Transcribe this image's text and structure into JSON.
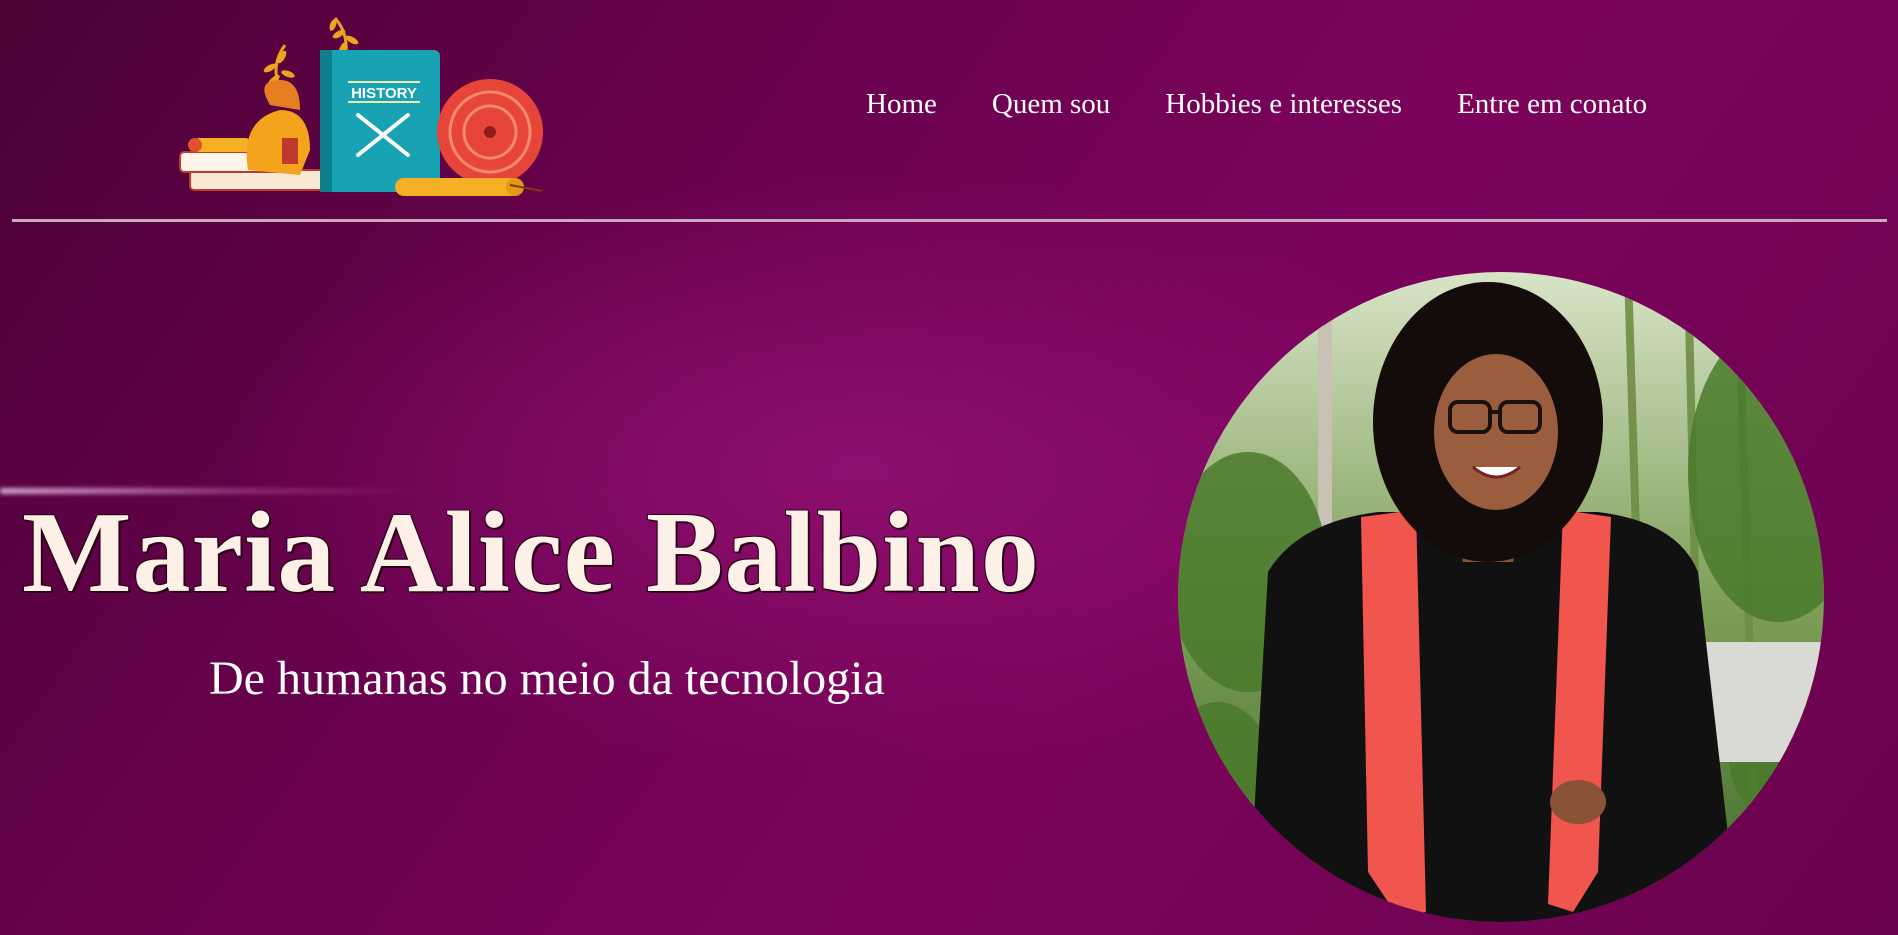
{
  "logo": {
    "book_label": "HISTORY"
  },
  "nav": {
    "items": [
      {
        "label": "Home"
      },
      {
        "label": "Quem sou"
      },
      {
        "label": "Hobbies e interesses"
      },
      {
        "label": "Entre em conato"
      }
    ]
  },
  "hero": {
    "title": "Maria Alice Balbino",
    "subtitle": "De humanas no meio da tecnologia"
  },
  "colors": {
    "background": "#6b0250",
    "title_text": "#fdf0e6",
    "divider": "#c9a9bc",
    "stole": "#f0554e",
    "gown": "#111111"
  }
}
